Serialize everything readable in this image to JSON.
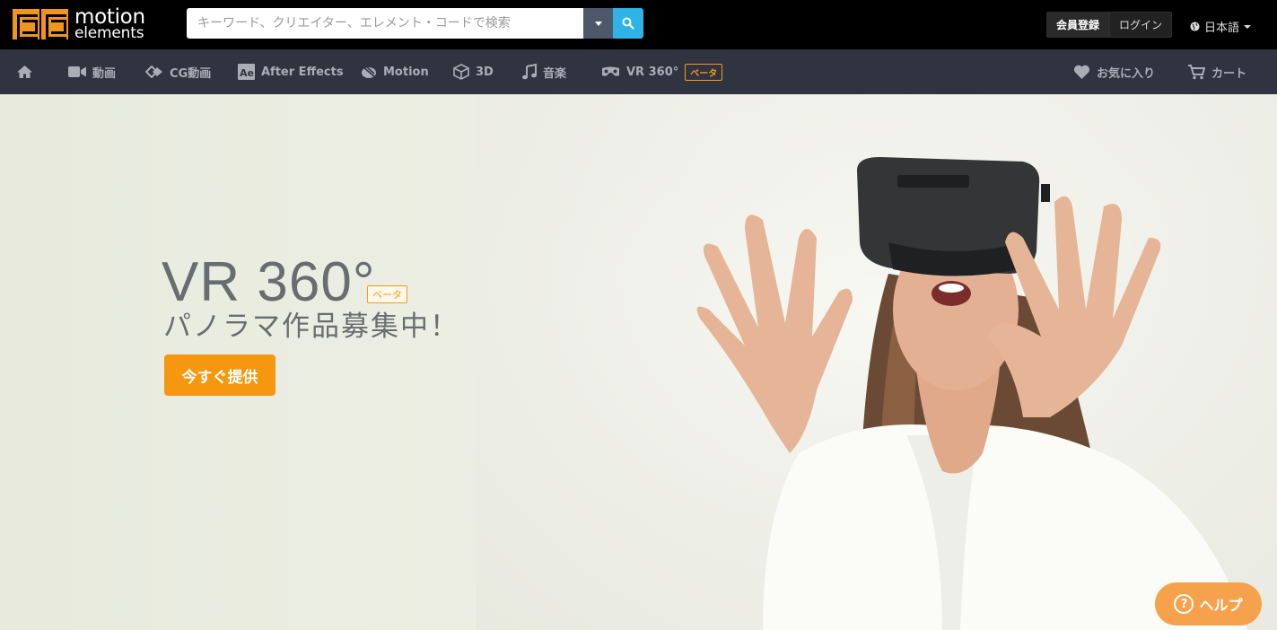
{
  "brand": {
    "line1": "motion",
    "line2": "elements"
  },
  "search": {
    "placeholder": "キーワード、クリエイター、エレメント・コードで検索"
  },
  "auth": {
    "register": "会員登録",
    "login": "ログイン"
  },
  "language": {
    "label": "日本語"
  },
  "nav": {
    "items": [
      {
        "label": "",
        "icon": "home-icon"
      },
      {
        "label": "動画",
        "icon": "video-camera-icon"
      },
      {
        "label": "CG動画",
        "icon": "cg-icon"
      },
      {
        "label": "After Effects",
        "icon": "after-effects-icon"
      },
      {
        "label": "Motion",
        "icon": "motion-icon"
      },
      {
        "label": "3D",
        "icon": "cube-icon"
      },
      {
        "label": "音楽",
        "icon": "music-note-icon"
      },
      {
        "label": "VR 360°",
        "icon": "vr-headset-icon",
        "badge": "ベータ"
      }
    ],
    "favorites": "お気に入り",
    "cart": "カート"
  },
  "hero": {
    "title": "VR 360°",
    "badge": "ベータ",
    "subtitle": "パノラマ作品募集中！",
    "cta": "今すぐ提供"
  },
  "help": {
    "label": "ヘルプ"
  },
  "colors": {
    "accent": "#f5970f",
    "nav_bg": "#2f3440",
    "search_button": "#2fb3e6"
  }
}
